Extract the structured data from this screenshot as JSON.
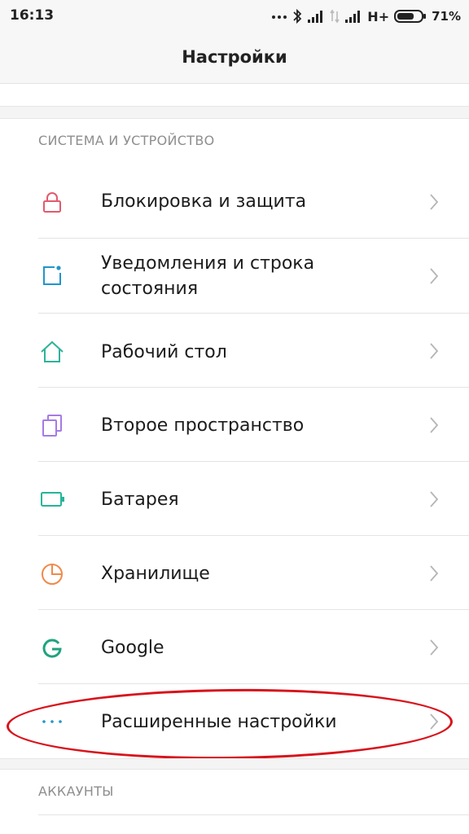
{
  "status_bar": {
    "time": "16:13",
    "network_type": "H+",
    "battery_percent": "71%",
    "more_icon": "more-dots-icon",
    "bluetooth_icon": "bluetooth-icon",
    "signal_icon": "signal-icon",
    "battery_icon": "battery-icon",
    "battery_level": 0.71
  },
  "app_bar": {
    "title": "Настройки"
  },
  "sections": [
    {
      "header": "СИСТЕМА И УСТРОЙСТВО",
      "items": [
        {
          "label": "Блокировка и защита",
          "icon": "lock-icon",
          "color": "#e25a6e"
        },
        {
          "label": "Уведомления и строка состояния",
          "icon": "notification-icon",
          "color": "#2196c9"
        },
        {
          "label": "Рабочий стол",
          "icon": "home-icon",
          "color": "#2fb29a"
        },
        {
          "label": "Второе пространство",
          "icon": "second-space-icon",
          "color": "#a67ae6"
        },
        {
          "label": "Батарея",
          "icon": "battery-icon",
          "color": "#25b59b"
        },
        {
          "label": "Хранилище",
          "icon": "storage-pie-icon",
          "color": "#f08a4b"
        },
        {
          "label": "Google",
          "icon": "google-icon",
          "color": "#1fa37f"
        },
        {
          "label": "Расширенные настройки",
          "icon": "more-dots-icon",
          "color": "#2196c9"
        }
      ]
    },
    {
      "header": "АККАУНТЫ",
      "items": []
    }
  ],
  "annotation": {
    "color": "#d8121b",
    "target": "Расширенные настройки"
  }
}
